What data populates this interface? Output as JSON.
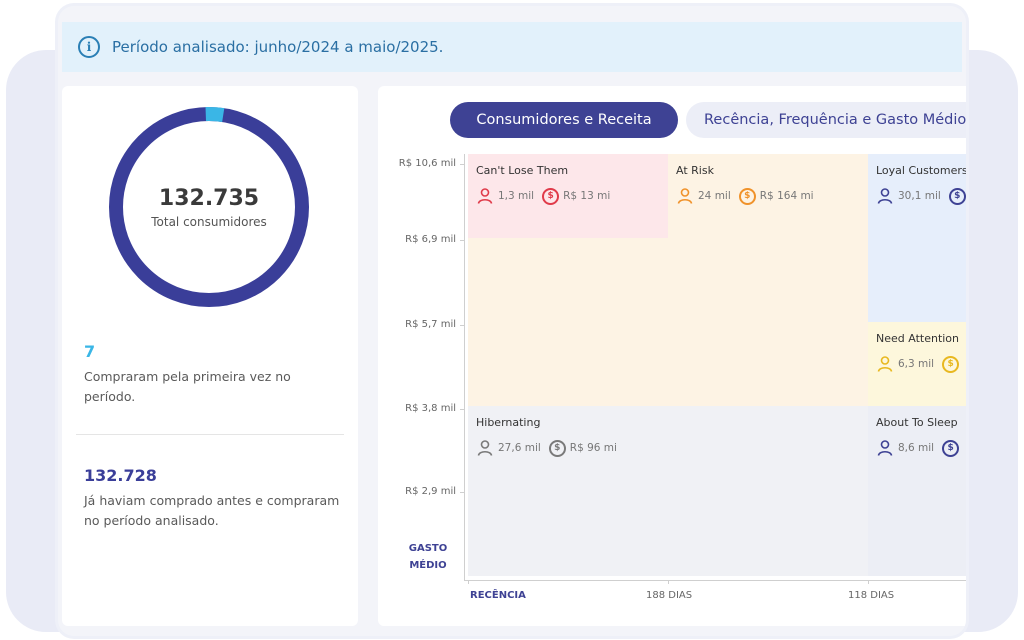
{
  "banner": {
    "text": "Período analisado: junho/2024 a maio/2025."
  },
  "summary": {
    "total": "132.735",
    "total_label": "Total consumidores",
    "donut_fraction_new": 0.03,
    "first_time": {
      "value": "7",
      "desc": "Compraram pela primeira vez no período."
    },
    "returning": {
      "value": "132.728",
      "desc": "Já haviam comprado antes e compraram no período analisado."
    }
  },
  "tabs": {
    "active": "Consumidores e Receita",
    "inactive": "Recência, Frequência e Gasto Médio"
  },
  "chart": {
    "y_ticks": [
      "R$ 10,6 mil",
      "R$ 6,9 mil",
      "R$ 5,7 mil",
      "R$ 3,8 mil",
      "R$ 2,9 mil"
    ],
    "y_title": [
      "GASTO",
      "MÉDIO"
    ],
    "x_title": "RECÊNCIA",
    "x_ticks": [
      "188 DIAS",
      "118 DIAS"
    ]
  },
  "segments": [
    {
      "name": "Can't Lose Them",
      "customers": "1,3 mil",
      "revenue": "R$ 13 mi",
      "color": "#e03b4a"
    },
    {
      "name": "At Risk",
      "customers": "24 mil",
      "revenue": "R$ 164 mi",
      "color": "#f0922a"
    },
    {
      "name": "Loyal Customers",
      "customers": "30,1 mil",
      "revenue": "",
      "color": "#3e4294"
    },
    {
      "name": "Need Attention",
      "customers": "6,3 mil",
      "revenue": "",
      "color": "#e8b820"
    },
    {
      "name": "Hibernating",
      "customers": "27,6 mil",
      "revenue": "R$ 96 mi",
      "color": "#7a7a7a"
    },
    {
      "name": "About To Sleep",
      "customers": "8,6 mil",
      "revenue": "",
      "color": "#3e4294"
    }
  ],
  "colors": {
    "accent": "#3e4294",
    "new_customers": "#3ab6e6",
    "banner_bg": "#e2f1fb"
  }
}
